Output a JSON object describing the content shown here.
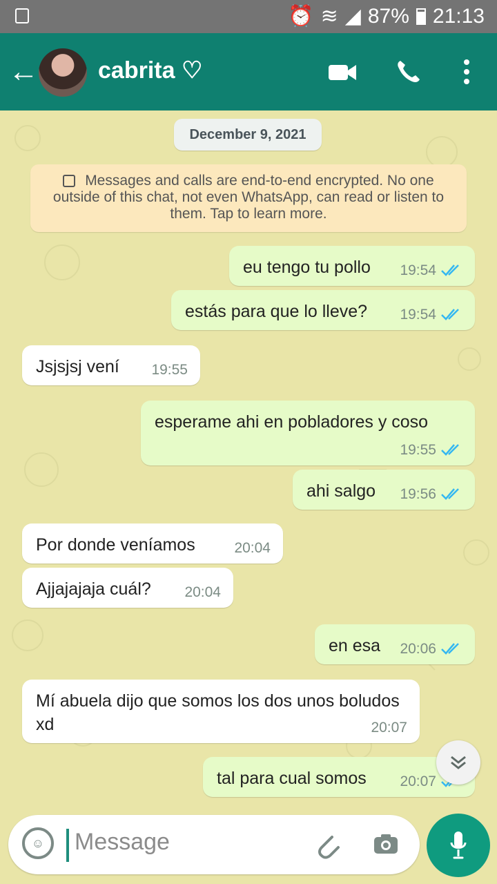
{
  "status_bar": {
    "battery_percent": "87%",
    "time": "21:13",
    "icons": [
      "recycle-icon",
      "alarm-icon",
      "wifi-icon",
      "signal-icon",
      "battery-icon"
    ]
  },
  "header": {
    "contact_name": "cabrita ♡",
    "icons": [
      "back-icon",
      "video-call-icon",
      "phone-icon",
      "more-icon"
    ]
  },
  "chat": {
    "date": "December 9, 2021",
    "encryption_notice": "Messages and calls are end-to-end encrypted. No one outside of this chat, not even WhatsApp, can read or listen to them. Tap to learn more.",
    "messages": [
      {
        "direction": "out",
        "text": "eu tengo tu pollo",
        "time": "19:54"
      },
      {
        "direction": "out",
        "text": "estás para que lo lleve?",
        "time": "19:54"
      },
      {
        "direction": "in",
        "text": "Jsjsjsj vení",
        "time": "19:55"
      },
      {
        "direction": "out",
        "text": "esperame ahi en pobladores y coso",
        "time": "19:55"
      },
      {
        "direction": "out",
        "text": "ahi salgo",
        "time": "19:56"
      },
      {
        "direction": "in",
        "text": "Por donde veníamos",
        "time": "20:04"
      },
      {
        "direction": "in",
        "text": "Ajjajajaja cuál?",
        "time": "20:04"
      },
      {
        "direction": "out",
        "text": "en esa",
        "time": "20:06"
      },
      {
        "direction": "in",
        "text": "Mí abuela dijo que somos los dos unos boludos xd",
        "time": "20:07"
      },
      {
        "direction": "out",
        "text": "tal para cual somos",
        "time": "20:07"
      }
    ]
  },
  "composer": {
    "placeholder": "Message",
    "icons": [
      "emoji-icon",
      "attach-icon",
      "camera-icon",
      "mic-icon"
    ]
  },
  "colors": {
    "header": "#0f8070",
    "chat_bg": "#e9e5a8",
    "outgoing_bubble": "#e6fbc8",
    "incoming_bubble": "#ffffff",
    "read_ticks": "#34b7f1",
    "mic_button": "#0f9b7f"
  }
}
